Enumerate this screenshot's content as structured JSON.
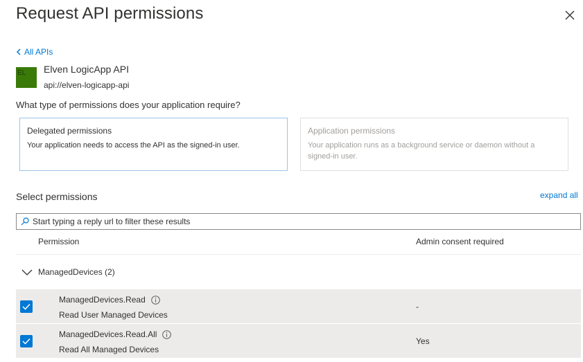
{
  "panel": {
    "title": "Request API permissions"
  },
  "nav": {
    "back_label": "All APIs"
  },
  "api": {
    "logo_text": "EL",
    "logo_color": "#3a7a09",
    "name": "Elven LogicApp API",
    "uri": "api://elven-logicapp-api"
  },
  "permission_type": {
    "question": "What type of permissions does your application require?",
    "options": [
      {
        "title": "Delegated permissions",
        "description": "Your application needs to access the API as the signed-in user.",
        "selected": true,
        "enabled": true
      },
      {
        "title": "Application permissions",
        "description": "Your application runs as a background service or daemon without a signed-in user.",
        "selected": false,
        "enabled": false
      }
    ]
  },
  "select_permissions": {
    "label": "Select permissions",
    "expand_all": "expand all",
    "search_placeholder": "Start typing a reply url to filter these results",
    "columns": {
      "permission": "Permission",
      "admin_consent": "Admin consent required"
    },
    "groups": [
      {
        "label": "ManagedDevices (2)",
        "expanded": true,
        "items": [
          {
            "name": "ManagedDevices.Read",
            "description": "Read User Managed Devices",
            "admin_consent": "-",
            "checked": true
          },
          {
            "name": "ManagedDevices.Read.All",
            "description": "Read All Managed Devices",
            "admin_consent": "Yes",
            "checked": true
          }
        ]
      }
    ]
  },
  "colors": {
    "accent": "#0078d4",
    "row_selected_bg": "#edebe9",
    "text": "#323130",
    "disabled_text": "#a19f9d"
  }
}
